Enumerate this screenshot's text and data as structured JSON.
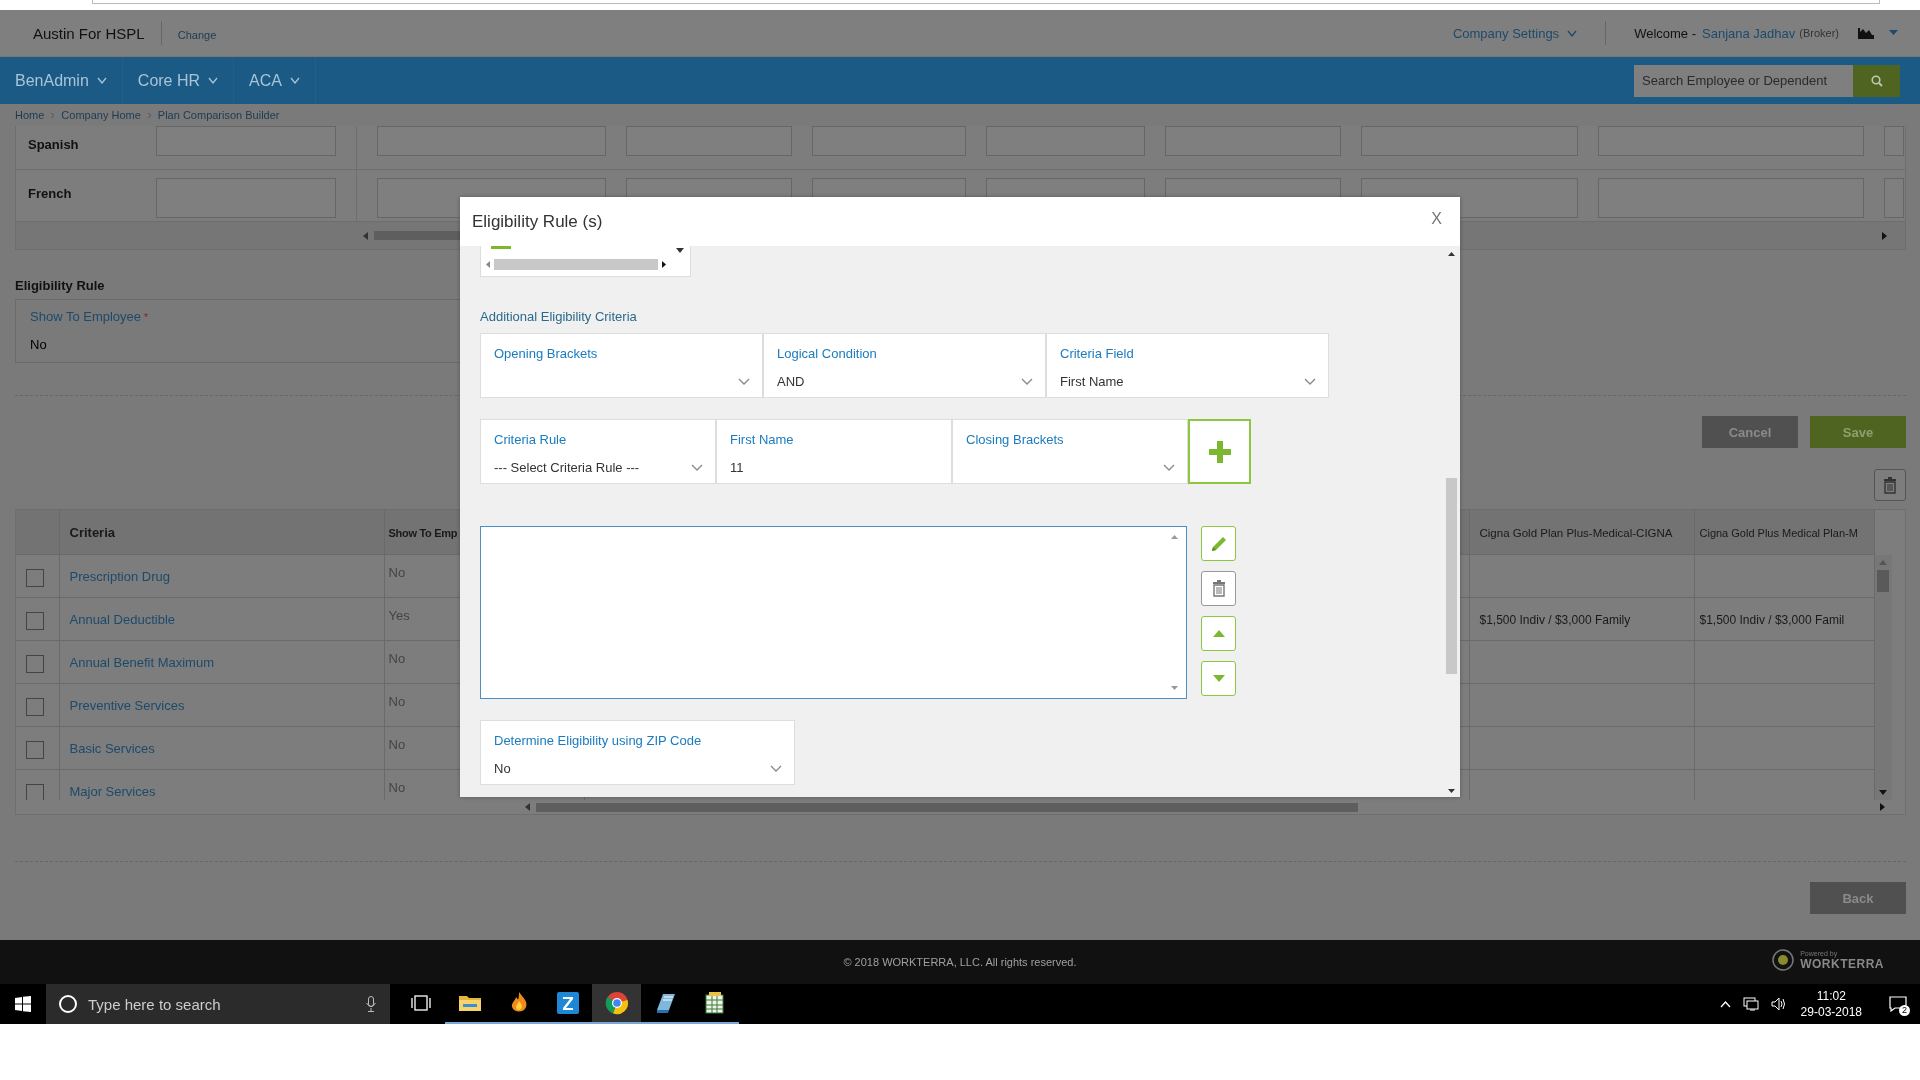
{
  "header": {
    "company": "Austin For HSPL",
    "change_link": "Change",
    "company_settings": "Company Settings",
    "welcome_label": "Welcome -",
    "user_name": "Sanjana Jadhav",
    "user_role": "(Broker)"
  },
  "nav": {
    "menus": [
      {
        "label": "BenAdmin"
      },
      {
        "label": "Core HR"
      },
      {
        "label": "ACA"
      }
    ],
    "search": {
      "placeholder": "Search Employee or Dependent"
    }
  },
  "breadcrumb": [
    "Home",
    "Company Home",
    "Plan Comparison Builder"
  ],
  "languages": [
    {
      "label": "Spanish"
    },
    {
      "label": "French"
    }
  ],
  "eligibility_rule": {
    "title": "Eligibility Rule",
    "field_label": "Show To Employee",
    "required_mark": "*",
    "value": "No"
  },
  "actions": [
    {
      "label": "Cancel",
      "kind": "secondary"
    },
    {
      "label": "Save",
      "kind": "primary"
    }
  ],
  "table": {
    "columns": [
      "Criteria",
      "Show To Emp",
      "Cigna Gold Plan Plus-Medical-CIGNA",
      "Cigna Gold Plus Medical Plan-M"
    ],
    "rows": [
      {
        "checked": false,
        "criteria": "Prescription Drug",
        "show": "No"
      },
      {
        "checked": false,
        "criteria": "Annual Deductible",
        "show": "Yes",
        "plan_1": "$1,500 Indiv / $3,000 Family",
        "plan_2": "$1,500 Indiv / $3,000 Famil"
      },
      {
        "checked": false,
        "criteria": "Annual Benefit Maximum",
        "show": "No"
      },
      {
        "checked": false,
        "criteria": "Preventive Services",
        "show": "No"
      },
      {
        "checked": false,
        "criteria": "Basic Services",
        "show": "No"
      },
      {
        "checked": false,
        "criteria": "Major Services",
        "show": "No"
      }
    ]
  },
  "back_button": "Back",
  "modal": {
    "title": "Eligibility Rule (s)",
    "close": "X",
    "section_title": "Additional Eligibility Criteria",
    "row_1": [
      {
        "label": "Opening Brackets",
        "kind": "select"
      },
      {
        "label": "Logical Condition",
        "value": "AND",
        "kind": "select"
      },
      {
        "label": "Criteria Field",
        "value": "First Name",
        "kind": "select"
      }
    ],
    "row_2": [
      {
        "label": "Criteria Rule",
        "value": "--- Select Criteria Rule ---",
        "kind": "select"
      },
      {
        "label": "First Name",
        "value": "11",
        "kind": "text"
      },
      {
        "label": "Closing Brackets",
        "kind": "select"
      }
    ],
    "tools": [
      {
        "kind": "edit"
      },
      {
        "kind": "delete"
      },
      {
        "kind": "up"
      },
      {
        "kind": "down"
      }
    ],
    "zip": {
      "label": "Determine Eligibility using ZIP Code",
      "value": "No",
      "kind": "select"
    }
  },
  "footer": {
    "copyright": "© 2018 WORKTERRA, LLC. All rights reserved.",
    "powered_by": "Powered by",
    "brand": "WORKTERRA"
  },
  "taskbar": {
    "search_placeholder": "Type here to search",
    "apps": [
      {
        "kind": "folder",
        "running": true,
        "active": false
      },
      {
        "kind": "flame",
        "running": true,
        "active": false
      },
      {
        "kind": "z",
        "running": true,
        "active": false
      },
      {
        "kind": "chrome",
        "running": true,
        "active": true
      },
      {
        "kind": "book",
        "running": true,
        "active": false
      },
      {
        "kind": "sheet",
        "running": true,
        "active": false
      }
    ],
    "time": "11:02",
    "date": "29-03-2018",
    "notifications": "2"
  }
}
